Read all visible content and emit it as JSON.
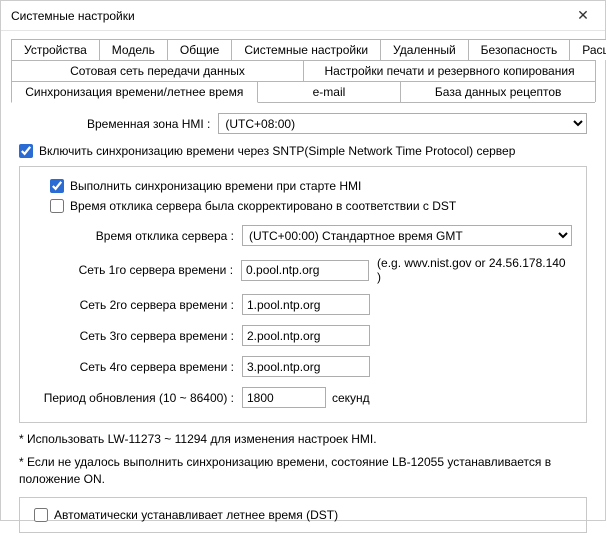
{
  "window": {
    "title": "Системные настройки"
  },
  "tabs": {
    "row1": [
      "Устройства",
      "Модель",
      "Общие",
      "Системные настройки",
      "Удаленный",
      "Безопасность",
      "Расширенная память"
    ],
    "row2": [
      "Сотовая сеть передачи данных",
      "Настройки печати и резервного копирования"
    ],
    "row3": [
      "Синхронизация времени/летнее время",
      "e-mail",
      "База данных рецептов"
    ],
    "active": "Синхронизация времени/летнее время"
  },
  "tz": {
    "label": "Временная зона HMI :",
    "value": "(UTC+08:00)"
  },
  "enable_sntp": {
    "label": "Включить синхронизацию времени через SNTP(Simple Network Time Protocol) сервер",
    "checked": true
  },
  "sync_on_start": {
    "label": "Выполнить синхронизацию времени при старте HMI",
    "checked": true
  },
  "dst_adjusted": {
    "label": "Время отклика сервера была скорректировано в соответствии с DST",
    "checked": false
  },
  "server_resp": {
    "label": "Время отклика сервера :",
    "value": "(UTC+00:00) Стандартное время GMT"
  },
  "srv1": {
    "label": "Сеть 1го сервера времени :",
    "value": "0.pool.ntp.org",
    "hint": "(e.g. wwv.nist.gov or 24.56.178.140 )"
  },
  "srv2": {
    "label": "Сеть 2го сервера времени :",
    "value": "1.pool.ntp.org"
  },
  "srv3": {
    "label": "Сеть 3го сервера времени :",
    "value": "2.pool.ntp.org"
  },
  "srv4": {
    "label": "Сеть 4го сервера времени :",
    "value": "3.pool.ntp.org"
  },
  "interval": {
    "label": "Период обновления (10 ~ 86400) :",
    "value": "1800",
    "unit": "секунд"
  },
  "notes": {
    "n1": "* Использовать LW-11273 ~ 11294 для изменения настроек HMI.",
    "n2": "* Если не удалось выполнить синхронизацию времени, состояние LB-12055 устанавливается в положение ON."
  },
  "auto_dst": {
    "label": "Автоматически устанавливает летнее время (DST)",
    "checked": false
  }
}
